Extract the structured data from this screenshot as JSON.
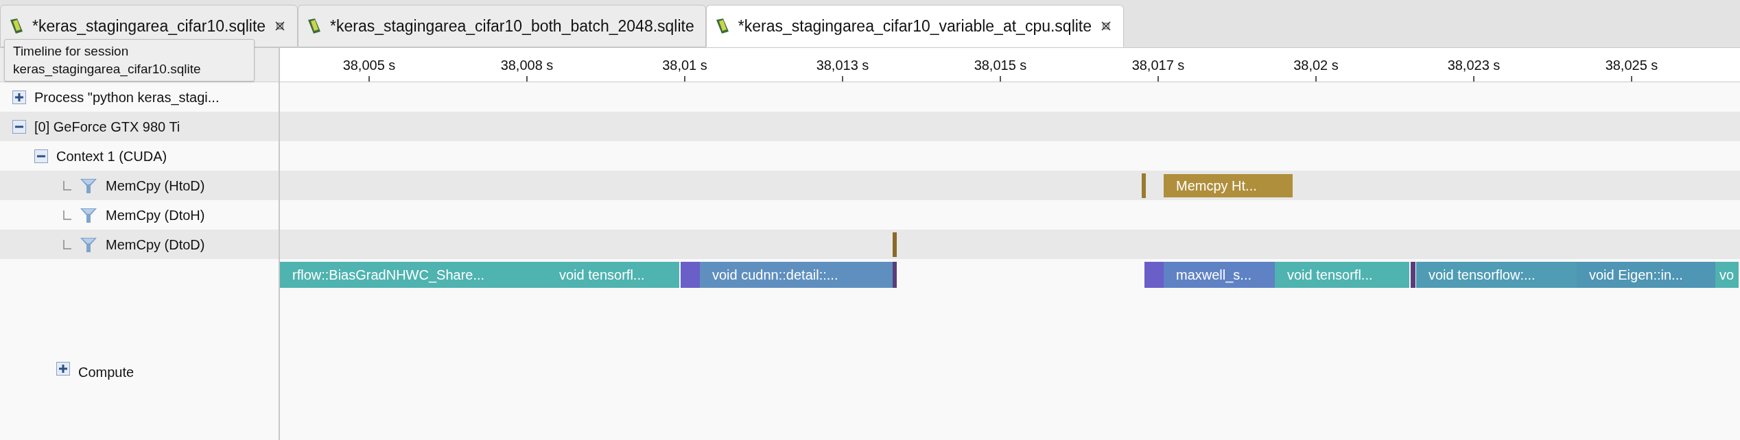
{
  "tabs": [
    {
      "label": "*keras_stagingarea_cifar10.sqlite",
      "selected": false,
      "closable": true
    },
    {
      "label": "*keras_stagingarea_cifar10_both_batch_2048.sqlite",
      "selected": false,
      "closable": false
    },
    {
      "label": "*keras_stagingarea_cifar10_variable_at_cpu.sqlite",
      "selected": true,
      "closable": true
    }
  ],
  "tooltip": {
    "lines": [
      "Timeline for session",
      "keras_stagingarea_cifar10.sqlite"
    ]
  },
  "ruler": {
    "ticks": [
      "38,005 s",
      "38,008 s",
      "38,01 s",
      "38,013 s",
      "38,015 s",
      "38,017 s",
      "38,02 s",
      "38,023 s",
      "38,025 s"
    ]
  },
  "tree": [
    {
      "label": "Process \"python keras_stagi...",
      "kind": "group",
      "expanded": false
    },
    {
      "label": "[0] GeForce GTX 980 Ti",
      "kind": "group",
      "expanded": true,
      "children": [
        {
          "label": "Context 1 (CUDA)",
          "kind": "group",
          "expanded": true,
          "children": [
            {
              "label": "MemCpy (HtoD)",
              "kind": "filter",
              "bars": [
                {
                  "color": "#9a7a30"
                },
                {
                  "label": "Memcpy Ht...",
                  "color": "#b08f3c"
                }
              ]
            },
            {
              "label": "MemCpy (DtoH)",
              "kind": "filter"
            },
            {
              "label": "MemCpy (DtoD)",
              "kind": "filter",
              "bars": [
                {
                  "color": "#8a6a2a"
                }
              ]
            },
            {
              "label": "Compute",
              "kind": "group",
              "expanded": false,
              "bars": [
                {
                  "label": "rflow::BiasGradNHWC_Share...",
                  "color": "#4fb3b0"
                },
                {
                  "label": "void tensorfl...",
                  "color": "#4fb3b0"
                },
                {
                  "color": "#6a5ec8"
                },
                {
                  "label": "void cudnn::detail::...",
                  "color": "#5f8fbf"
                },
                {
                  "color": "#5a3d7a"
                },
                {
                  "color": "#6a5ec8"
                },
                {
                  "label": "maxwell_s...",
                  "color": "#5f82c4"
                },
                {
                  "label": "void tensorfl...",
                  "color": "#4fb3b0"
                },
                {
                  "color": "#5a3d7a"
                },
                {
                  "label": "void tensorflow:...",
                  "color": "#4f9cb4"
                },
                {
                  "label": "void Eigen::in...",
                  "color": "#4f95b4"
                },
                {
                  "label": "vo",
                  "color": "#4fb3b0"
                }
              ]
            }
          ]
        }
      ]
    }
  ]
}
